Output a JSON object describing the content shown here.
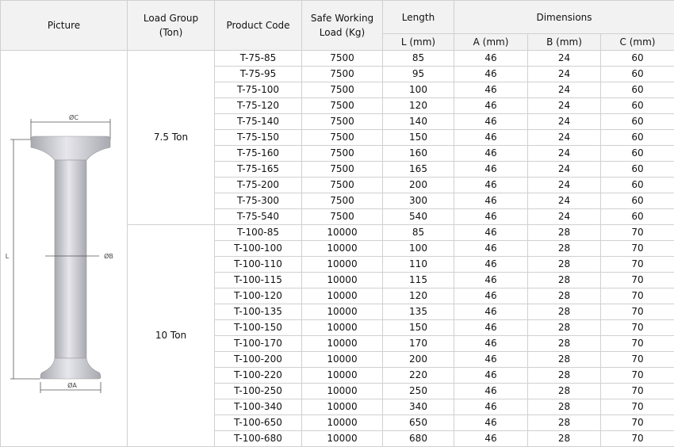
{
  "header": {
    "picture": "Picture",
    "load_group": "Load Group\n(Ton)",
    "product_code": "Product Code",
    "safe_working_load": "Safe Working\nLoad (Kg)",
    "length": "Length",
    "dimensions": "Dimensions",
    "length_unit": "L (mm)",
    "dim_a": "A (mm)",
    "dim_b": "B (mm)",
    "dim_c": "C (mm)"
  },
  "drawing": {
    "label_c": "ØC",
    "label_b": "ØB",
    "label_a": "ØA",
    "label_l": "L",
    "shade_light": "#e6e6ec",
    "shade_dark": "#a8a8b0"
  },
  "groups": [
    {
      "label": "7.5 Ton",
      "rows": [
        {
          "code": "T-75-85",
          "swl": "7500",
          "length": "85",
          "a": "46",
          "b": "24",
          "c": "60"
        },
        {
          "code": "T-75-95",
          "swl": "7500",
          "length": "95",
          "a": "46",
          "b": "24",
          "c": "60"
        },
        {
          "code": "T-75-100",
          "swl": "7500",
          "length": "100",
          "a": "46",
          "b": "24",
          "c": "60"
        },
        {
          "code": "T-75-120",
          "swl": "7500",
          "length": "120",
          "a": "46",
          "b": "24",
          "c": "60"
        },
        {
          "code": "T-75-140",
          "swl": "7500",
          "length": "140",
          "a": "46",
          "b": "24",
          "c": "60"
        },
        {
          "code": "T-75-150",
          "swl": "7500",
          "length": "150",
          "a": "46",
          "b": "24",
          "c": "60"
        },
        {
          "code": "T-75-160",
          "swl": "7500",
          "length": "160",
          "a": "46",
          "b": "24",
          "c": "60"
        },
        {
          "code": "T-75-165",
          "swl": "7500",
          "length": "165",
          "a": "46",
          "b": "24",
          "c": "60"
        },
        {
          "code": "T-75-200",
          "swl": "7500",
          "length": "200",
          "a": "46",
          "b": "24",
          "c": "60"
        },
        {
          "code": "T-75-300",
          "swl": "7500",
          "length": "300",
          "a": "46",
          "b": "24",
          "c": "60"
        },
        {
          "code": "T-75-540",
          "swl": "7500",
          "length": "540",
          "a": "46",
          "b": "24",
          "c": "60"
        }
      ]
    },
    {
      "label": "10 Ton",
      "rows": [
        {
          "code": "T-100-85",
          "swl": "10000",
          "length": "85",
          "a": "46",
          "b": "28",
          "c": "70"
        },
        {
          "code": "T-100-100",
          "swl": "10000",
          "length": "100",
          "a": "46",
          "b": "28",
          "c": "70"
        },
        {
          "code": "T-100-110",
          "swl": "10000",
          "length": "110",
          "a": "46",
          "b": "28",
          "c": "70"
        },
        {
          "code": "T-100-115",
          "swl": "10000",
          "length": "115",
          "a": "46",
          "b": "28",
          "c": "70"
        },
        {
          "code": "T-100-120",
          "swl": "10000",
          "length": "120",
          "a": "46",
          "b": "28",
          "c": "70"
        },
        {
          "code": "T-100-135",
          "swl": "10000",
          "length": "135",
          "a": "46",
          "b": "28",
          "c": "70"
        },
        {
          "code": "T-100-150",
          "swl": "10000",
          "length": "150",
          "a": "46",
          "b": "28",
          "c": "70"
        },
        {
          "code": "T-100-170",
          "swl": "10000",
          "length": "170",
          "a": "46",
          "b": "28",
          "c": "70"
        },
        {
          "code": "T-100-200",
          "swl": "10000",
          "length": "200",
          "a": "46",
          "b": "28",
          "c": "70"
        },
        {
          "code": "T-100-220",
          "swl": "10000",
          "length": "220",
          "a": "46",
          "b": "28",
          "c": "70"
        },
        {
          "code": "T-100-250",
          "swl": "10000",
          "length": "250",
          "a": "46",
          "b": "28",
          "c": "70"
        },
        {
          "code": "T-100-340",
          "swl": "10000",
          "length": "340",
          "a": "46",
          "b": "28",
          "c": "70"
        },
        {
          "code": "T-100-650",
          "swl": "10000",
          "length": "650",
          "a": "46",
          "b": "28",
          "c": "70"
        },
        {
          "code": "T-100-680",
          "swl": "10000",
          "length": "680",
          "a": "46",
          "b": "28",
          "c": "70"
        }
      ]
    }
  ]
}
